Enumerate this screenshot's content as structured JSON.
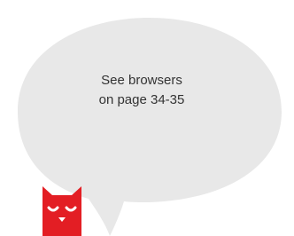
{
  "callout": {
    "line1": "See browsers",
    "line2": "on page 34-35"
  },
  "colors": {
    "bubble_fill": "#e8e8e8",
    "mascot": "#e31e24",
    "mascot_face": "#ffffff"
  },
  "icons": {
    "mascot": "sleepy-cat-mascot-icon"
  }
}
